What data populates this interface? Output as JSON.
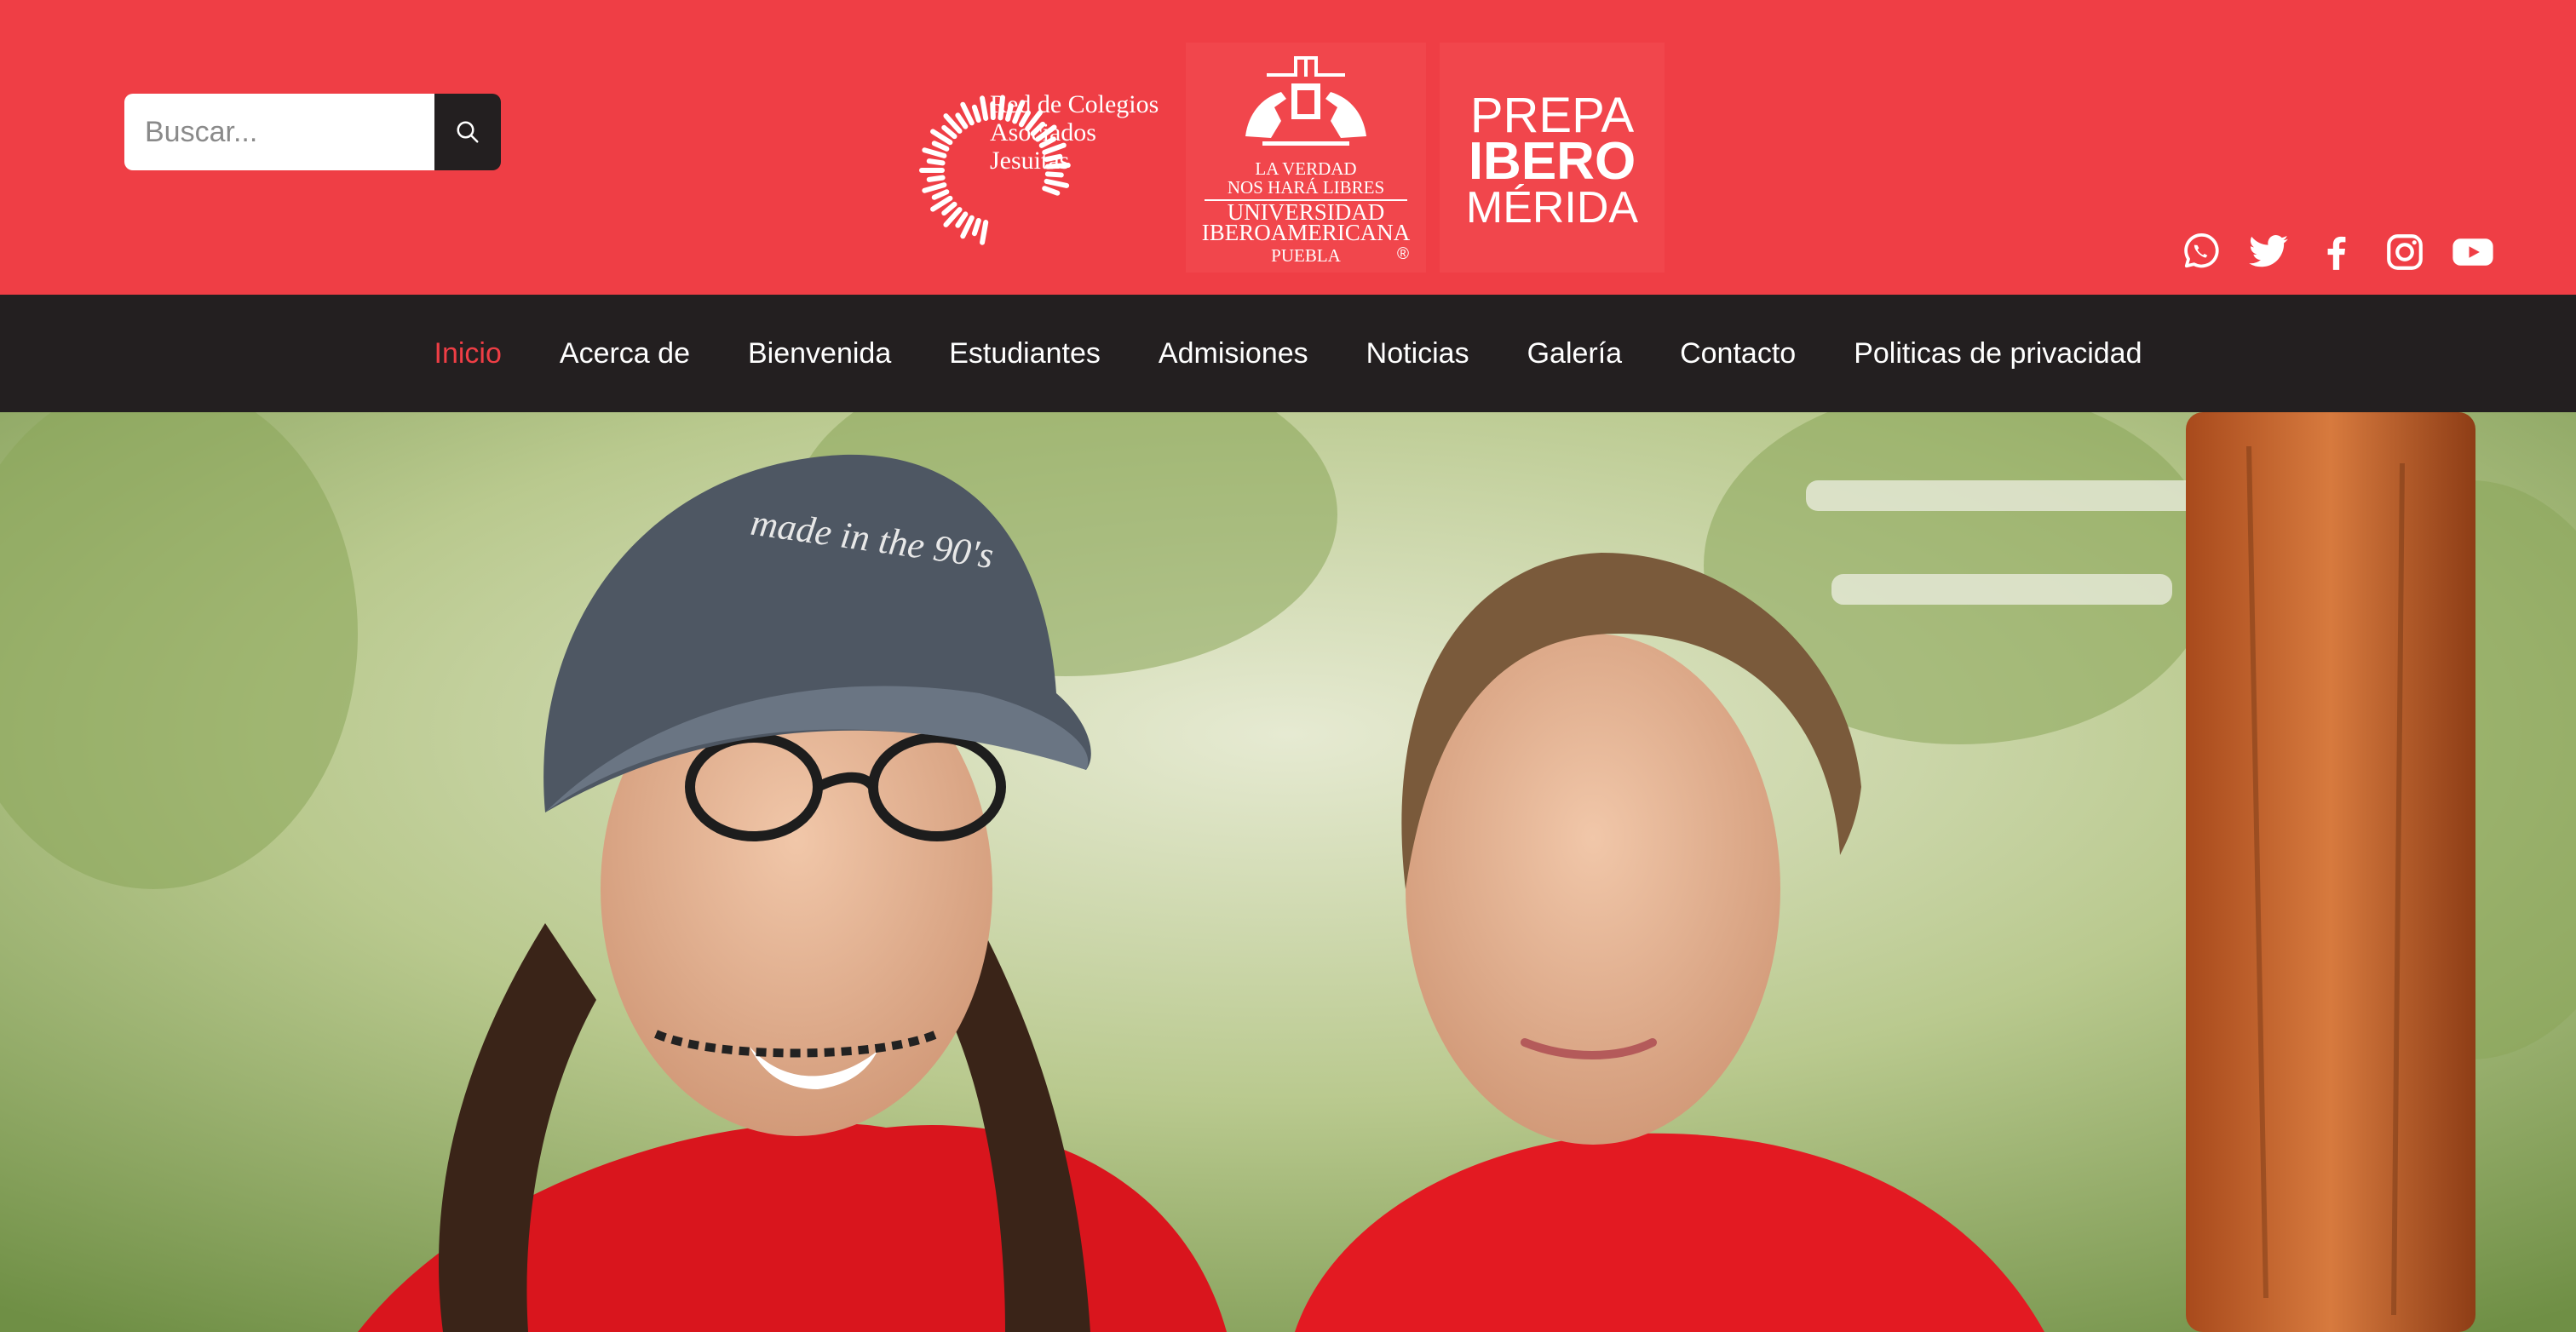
{
  "search": {
    "placeholder": "Buscar..."
  },
  "logos": {
    "crcaj": {
      "lines": [
        "Red de Colegios",
        "Asociados",
        "Jesuitas"
      ]
    },
    "ibero": {
      "line1": "LA VERDAD",
      "line2": "NOS HARÁ LIBRES",
      "line3": "UNIVERSIDAD",
      "line4": "IBEROAMERICANA",
      "line5": "PUEBLA",
      "mark": "®"
    },
    "prepa": {
      "line1": "PREPA",
      "line2": "IBERO",
      "line3": "MÉRIDA"
    }
  },
  "social": [
    "whatsapp-icon",
    "twitter-icon",
    "facebook-icon",
    "instagram-icon",
    "youtube-icon"
  ],
  "nav": {
    "active": "Inicio",
    "items": [
      "Inicio",
      "Acerca de",
      "Bienvenida",
      "Estudiantes",
      "Admisiones",
      "Noticias",
      "Galería",
      "Contacto",
      "Politicas de privacidad"
    ]
  },
  "hero": {
    "photo": "two-students-red-shirts-outdoors",
    "cap_text": "made in the 90's"
  },
  "colors": {
    "brand_red": "#ef3e45",
    "nav_dark": "#231f20",
    "text_white": "#ffffff"
  }
}
